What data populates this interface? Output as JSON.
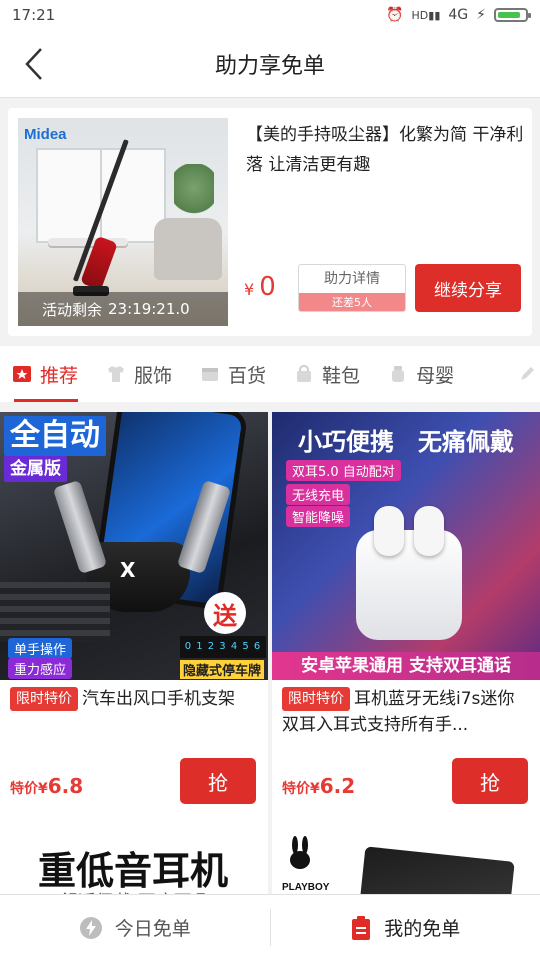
{
  "status": {
    "time": "17:21",
    "network": "4G",
    "hd": "HD"
  },
  "header": {
    "title": "助力享免单"
  },
  "promo": {
    "brand": "Midea",
    "title": "【美的手持吸尘器】化繁为简 干净利落 让清洁更有趣",
    "timer_label": "活动剩余",
    "timer_value": "23:19:21.0",
    "currency": "¥",
    "price": "0",
    "detail_label": "助力详情",
    "detail_sub": "还差5人",
    "share_label": "继续分享"
  },
  "tabs": [
    {
      "label": "推荐",
      "icon": "star-badge-icon",
      "active": true
    },
    {
      "label": "服饰",
      "icon": "shirt-icon"
    },
    {
      "label": "百货",
      "icon": "box-icon"
    },
    {
      "label": "鞋包",
      "icon": "bag-icon"
    },
    {
      "label": "母婴",
      "icon": "baby-icon"
    }
  ],
  "products": [
    {
      "img_text": {
        "headline": "全自动",
        "sub": "金属版",
        "badge1": "单手操作",
        "badge2": "重力感应",
        "gift": "送",
        "gift_sub": "隐藏式停车牌"
      },
      "tag": "限时特价",
      "title": "汽车出风口手机支架",
      "price_label": "特价",
      "currency": "¥",
      "price": "6.8",
      "button": "抢"
    },
    {
      "img_text": {
        "headline1": "小巧便携",
        "headline2": "无痛佩戴",
        "pill1": "双耳5.0  自动配对",
        "pill2": "无线充电",
        "pill3": "智能降噪",
        "footer": "安卓苹果通用 支持双耳通话"
      },
      "tag": "限时特价",
      "title": "耳机蓝牙无线i7s迷你双耳入耳式支持所有手...",
      "price_label": "特价",
      "currency": "¥",
      "price": "6.2",
      "button": "抢"
    }
  ],
  "next_row": {
    "left_text": "重低音耳机",
    "left_sub": "舒适佩戴 不痛耳朵",
    "right_brand": "PLAYBOY"
  },
  "bottom_nav": [
    {
      "label": "今日免单",
      "icon": "lightning-icon"
    },
    {
      "label": "我的免单",
      "icon": "clipboard-icon",
      "active": true
    }
  ],
  "colors": {
    "accent": "#dd2e2a",
    "price": "#e43a36",
    "blue": "#1e66d8"
  }
}
